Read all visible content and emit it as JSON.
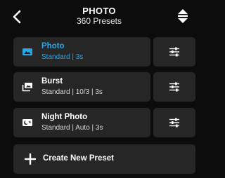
{
  "header": {
    "title": "PHOTO",
    "subtitle": "360 Presets",
    "back_icon": "chevron-left-icon",
    "sort_icon": "sort-arrows-icon"
  },
  "presets": [
    {
      "name": "Photo",
      "detail": "Standard | 3s",
      "icon": "photo-mode-icon",
      "active": true
    },
    {
      "name": "Burst",
      "detail": "Standard | 10/3 | 3s",
      "icon": "burst-mode-icon",
      "active": false
    },
    {
      "name": "Night Photo",
      "detail": "Standard | Auto | 3s",
      "icon": "night-photo-mode-icon",
      "active": false
    }
  ],
  "create_button": {
    "label": "Create New Preset",
    "icon": "plus-icon"
  },
  "colors": {
    "accent": "#2aa6e6",
    "card": "#262626",
    "background": "#0c0c0c"
  }
}
